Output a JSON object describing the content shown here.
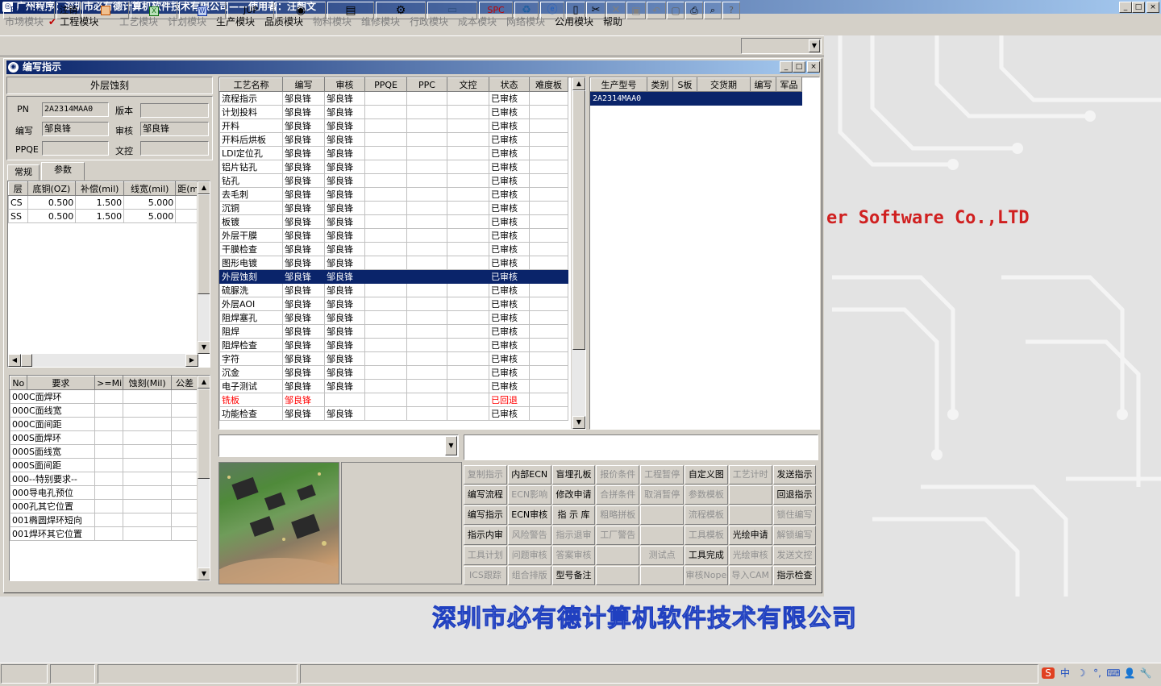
{
  "app": {
    "title": "广州程序：深圳市必有德计算机软件技术有限公司——使用者：汪朝文",
    "min": "_",
    "max": "□",
    "close": "×"
  },
  "menus": [
    {
      "label": "市场模块",
      "on": false
    },
    {
      "label": "工程模块",
      "on": true,
      "checked": true
    },
    {
      "label": "工艺模块",
      "on": false
    },
    {
      "label": "计划模块",
      "on": false
    },
    {
      "label": "生产模块",
      "on": true
    },
    {
      "label": "品质模块",
      "on": true
    },
    {
      "label": "物料模块",
      "on": false
    },
    {
      "label": "维修模块",
      "on": false
    },
    {
      "label": "行政模块",
      "on": false
    },
    {
      "label": "成本模块",
      "on": false
    },
    {
      "label": "网络模块",
      "on": false
    },
    {
      "label": "公用模块",
      "on": true
    },
    {
      "label": "帮助",
      "on": true
    }
  ],
  "toolbar": {
    "builder": "Builder",
    "logout": "注销",
    "jup": "JUP",
    "spc": "SPC",
    "icons": [
      "ppt-icon",
      "excel-icon",
      "word-icon",
      "eye-icon",
      "database-icon",
      "gears-icon",
      "computer-icon",
      "recycle-icon",
      "ie-icon",
      "new-file-icon",
      "cut-icon",
      "delete-icon",
      "save-icon",
      "undo-icon",
      "preview-icon",
      "print-icon",
      "find-icon",
      "help-icon"
    ]
  },
  "desktop": {
    "brand": "er Software Co.,LTD",
    "company": "深圳市必有德计算机软件技术有限公司"
  },
  "child": {
    "title": "编写指示",
    "process_name": "外层蚀刻",
    "pn_label": "PN",
    "pn": "2A2314MAA0",
    "version_label": "版本",
    "version": "",
    "author_label": "编写",
    "author": "邹良锋",
    "reviewer_label": "审核",
    "reviewer": "邹良锋",
    "ppqe_label": "PPQE",
    "ppqe": "",
    "doc_label": "文控",
    "doc": "",
    "tabs": [
      "常规",
      "参数"
    ]
  },
  "params": {
    "headers": [
      "层",
      "底铜(OZ)",
      "补偿(mil)",
      "线宽(mil)",
      "距(mi"
    ],
    "rows": [
      [
        "CS",
        "0.500",
        "1.500",
        "5.000",
        ""
      ],
      [
        "SS",
        "0.500",
        "1.500",
        "5.000",
        ""
      ]
    ]
  },
  "reqs": {
    "headers": [
      "No",
      "要求",
      ">=Mil",
      "蚀刻(Mil)",
      "公差"
    ],
    "rows": [
      [
        "000",
        "C面焊环"
      ],
      [
        "000",
        "C面线宽"
      ],
      [
        "000",
        "C面间距"
      ],
      [
        "000",
        "S面焊环"
      ],
      [
        "000",
        "S面线宽"
      ],
      [
        "000",
        "S面间距"
      ],
      [
        "000",
        "--特别要求--"
      ],
      [
        "000",
        "导电孔预位"
      ],
      [
        "000",
        "孔其它位置"
      ],
      [
        "001",
        "椭圆焊环短向"
      ],
      [
        "001",
        "焊环其它位置"
      ]
    ]
  },
  "process": {
    "headers": [
      "工艺名称",
      "编写",
      "审核",
      "PPQE",
      "PPC",
      "文控",
      "状态",
      "难度板"
    ],
    "rows": [
      {
        "name": "流程指示",
        "author": "邹良锋",
        "reviewer": "邹良锋",
        "status": "已审核"
      },
      {
        "name": "计划投料",
        "author": "邹良锋",
        "reviewer": "邹良锋",
        "status": "已审核"
      },
      {
        "name": "开料",
        "author": "邹良锋",
        "reviewer": "邹良锋",
        "status": "已审核"
      },
      {
        "name": "开料后烘板",
        "author": "邹良锋",
        "reviewer": "邹良锋",
        "status": "已审核"
      },
      {
        "name": "LDI定位孔",
        "author": "邹良锋",
        "reviewer": "邹良锋",
        "status": "已审核"
      },
      {
        "name": "铝片钻孔",
        "author": "邹良锋",
        "reviewer": "邹良锋",
        "status": "已审核"
      },
      {
        "name": "钻孔",
        "author": "邹良锋",
        "reviewer": "邹良锋",
        "status": "已审核"
      },
      {
        "name": "去毛刺",
        "author": "邹良锋",
        "reviewer": "邹良锋",
        "status": "已审核"
      },
      {
        "name": "沉铜",
        "author": "邹良锋",
        "reviewer": "邹良锋",
        "status": "已审核"
      },
      {
        "name": "板镀",
        "author": "邹良锋",
        "reviewer": "邹良锋",
        "status": "已审核"
      },
      {
        "name": "外层干膜",
        "author": "邹良锋",
        "reviewer": "邹良锋",
        "status": "已审核"
      },
      {
        "name": "干膜检查",
        "author": "邹良锋",
        "reviewer": "邹良锋",
        "status": "已审核"
      },
      {
        "name": "图形电镀",
        "author": "邹良锋",
        "reviewer": "邹良锋",
        "status": "已审核"
      },
      {
        "name": "外层蚀刻",
        "author": "邹良锋",
        "reviewer": "邹良锋",
        "status": "已审核",
        "selected": true
      },
      {
        "name": "硫脲洗",
        "author": "邹良锋",
        "reviewer": "邹良锋",
        "status": "已审核"
      },
      {
        "name": "外层AOI",
        "author": "邹良锋",
        "reviewer": "邹良锋",
        "status": "已审核"
      },
      {
        "name": "阻焊塞孔",
        "author": "邹良锋",
        "reviewer": "邹良锋",
        "status": "已审核"
      },
      {
        "name": "阻焊",
        "author": "邹良锋",
        "reviewer": "邹良锋",
        "status": "已审核"
      },
      {
        "name": "阻焊检查",
        "author": "邹良锋",
        "reviewer": "邹良锋",
        "status": "已审核"
      },
      {
        "name": "字符",
        "author": "邹良锋",
        "reviewer": "邹良锋",
        "status": "已审核"
      },
      {
        "name": "沉金",
        "author": "邹良锋",
        "reviewer": "邹良锋",
        "status": "已审核"
      },
      {
        "name": "电子测试",
        "author": "邹良锋",
        "reviewer": "邹良锋",
        "status": "已审核"
      },
      {
        "name": "铣板",
        "author": "邹良锋",
        "reviewer": "",
        "status": "已回退",
        "returned": true
      },
      {
        "name": "功能检查",
        "author": "邹良锋",
        "reviewer": "邹良锋",
        "status": "已审核"
      }
    ]
  },
  "models": {
    "headers": [
      "生产型号",
      "类别",
      "S板",
      "交货期",
      "编写",
      "军品"
    ],
    "rows": [
      [
        "2A2314MAA0",
        "",
        "",
        "",
        "",
        ""
      ]
    ]
  },
  "buttons": [
    [
      "复制指示",
      "内部ECN",
      "盲埋孔板",
      "报价条件",
      "工程暂停",
      "自定义图",
      "工艺计时",
      "发送指示"
    ],
    [
      "编写流程",
      "ECN影响",
      "修改申请",
      "合拼条件",
      "取消暂停",
      "参数模板",
      "",
      "回退指示"
    ],
    [
      "编写指示",
      "ECN审核",
      "指 示 库",
      "粗略拼板",
      "",
      "流程模板",
      "",
      "锁住编写"
    ],
    [
      "指示内审",
      "风险警告",
      "指示退审",
      "工厂警告",
      "",
      "工具模板",
      "光绘申请",
      "解锁编写"
    ],
    [
      "工具计划",
      "问题审核",
      "答案审核",
      "",
      "测试点",
      "工具完成",
      "光绘审核",
      "发送文控"
    ],
    [
      "ICS跟踪",
      "组合排版",
      "型号备注",
      "",
      "",
      "审核Nope",
      "导入CAM",
      "指示检查"
    ]
  ],
  "buttons_enabled": [
    [
      0,
      1,
      1,
      0,
      0,
      1,
      0,
      1
    ],
    [
      1,
      0,
      1,
      0,
      0,
      0,
      0,
      1
    ],
    [
      1,
      1,
      1,
      0,
      0,
      0,
      0,
      0
    ],
    [
      1,
      0,
      0,
      0,
      0,
      0,
      1,
      0
    ],
    [
      0,
      0,
      0,
      0,
      0,
      1,
      0,
      0
    ],
    [
      0,
      0,
      1,
      0,
      0,
      0,
      0,
      1
    ]
  ],
  "tray": [
    "S",
    "中",
    "☽",
    "°,",
    "⌨",
    "👤",
    "🔧"
  ]
}
